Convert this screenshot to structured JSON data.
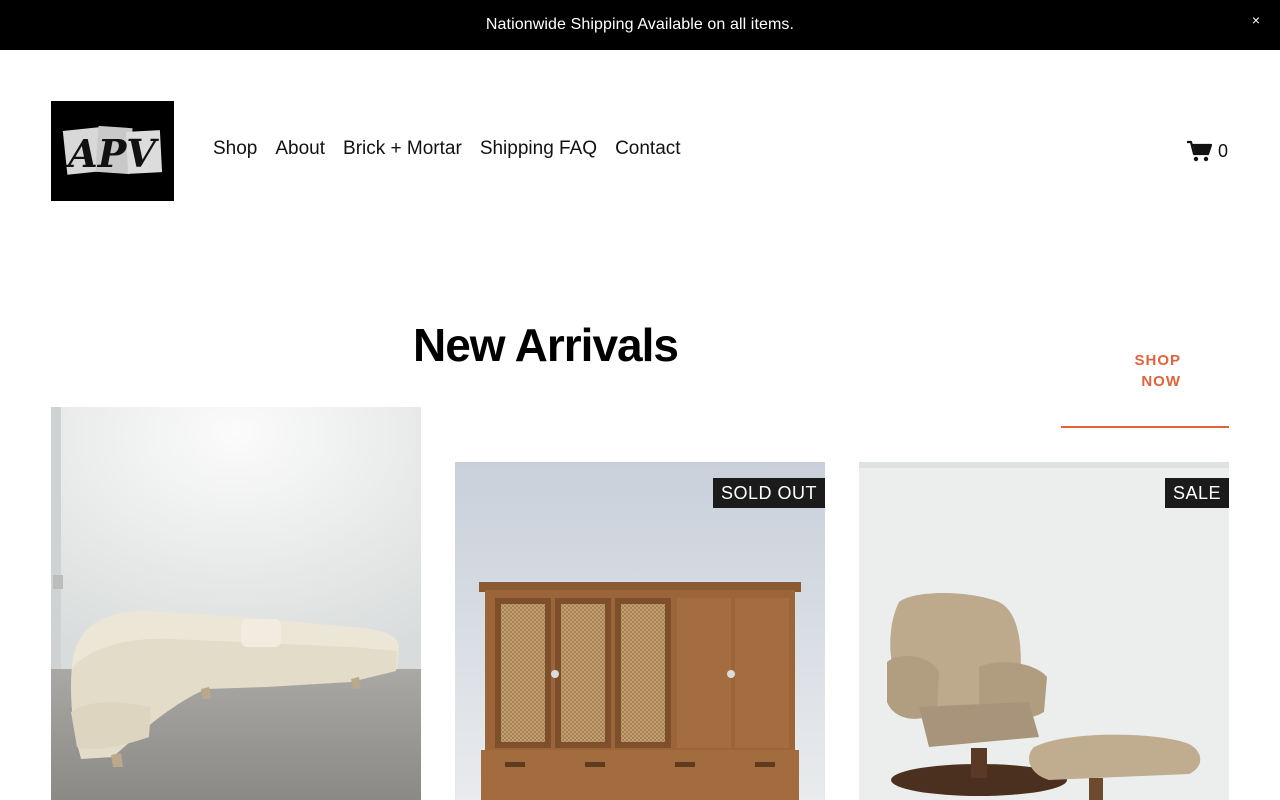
{
  "announcement": {
    "text": "Nationwide Shipping Available on all items.",
    "close_label": "×"
  },
  "logo": {
    "text": "APV"
  },
  "nav": {
    "items": [
      {
        "label": "Shop"
      },
      {
        "label": "About"
      },
      {
        "label": "Brick + Mortar"
      },
      {
        "label": "Shipping FAQ"
      },
      {
        "label": "Contact"
      }
    ]
  },
  "cart": {
    "count": "0",
    "icon": "cart-icon"
  },
  "section": {
    "title": "New Arrivals",
    "cta_line1": "SHOP",
    "cta_line2": "NOW"
  },
  "products": [
    {
      "badge": "",
      "image": "curved-sectional-sofa"
    },
    {
      "badge": "SOLD OUT",
      "image": "walnut-cane-cabinet"
    },
    {
      "badge": "SALE",
      "image": "leather-recliner-ottoman"
    }
  ],
  "colors": {
    "accent": "#e0633c",
    "banner": "#000000",
    "badge": "#1b1b1b"
  }
}
